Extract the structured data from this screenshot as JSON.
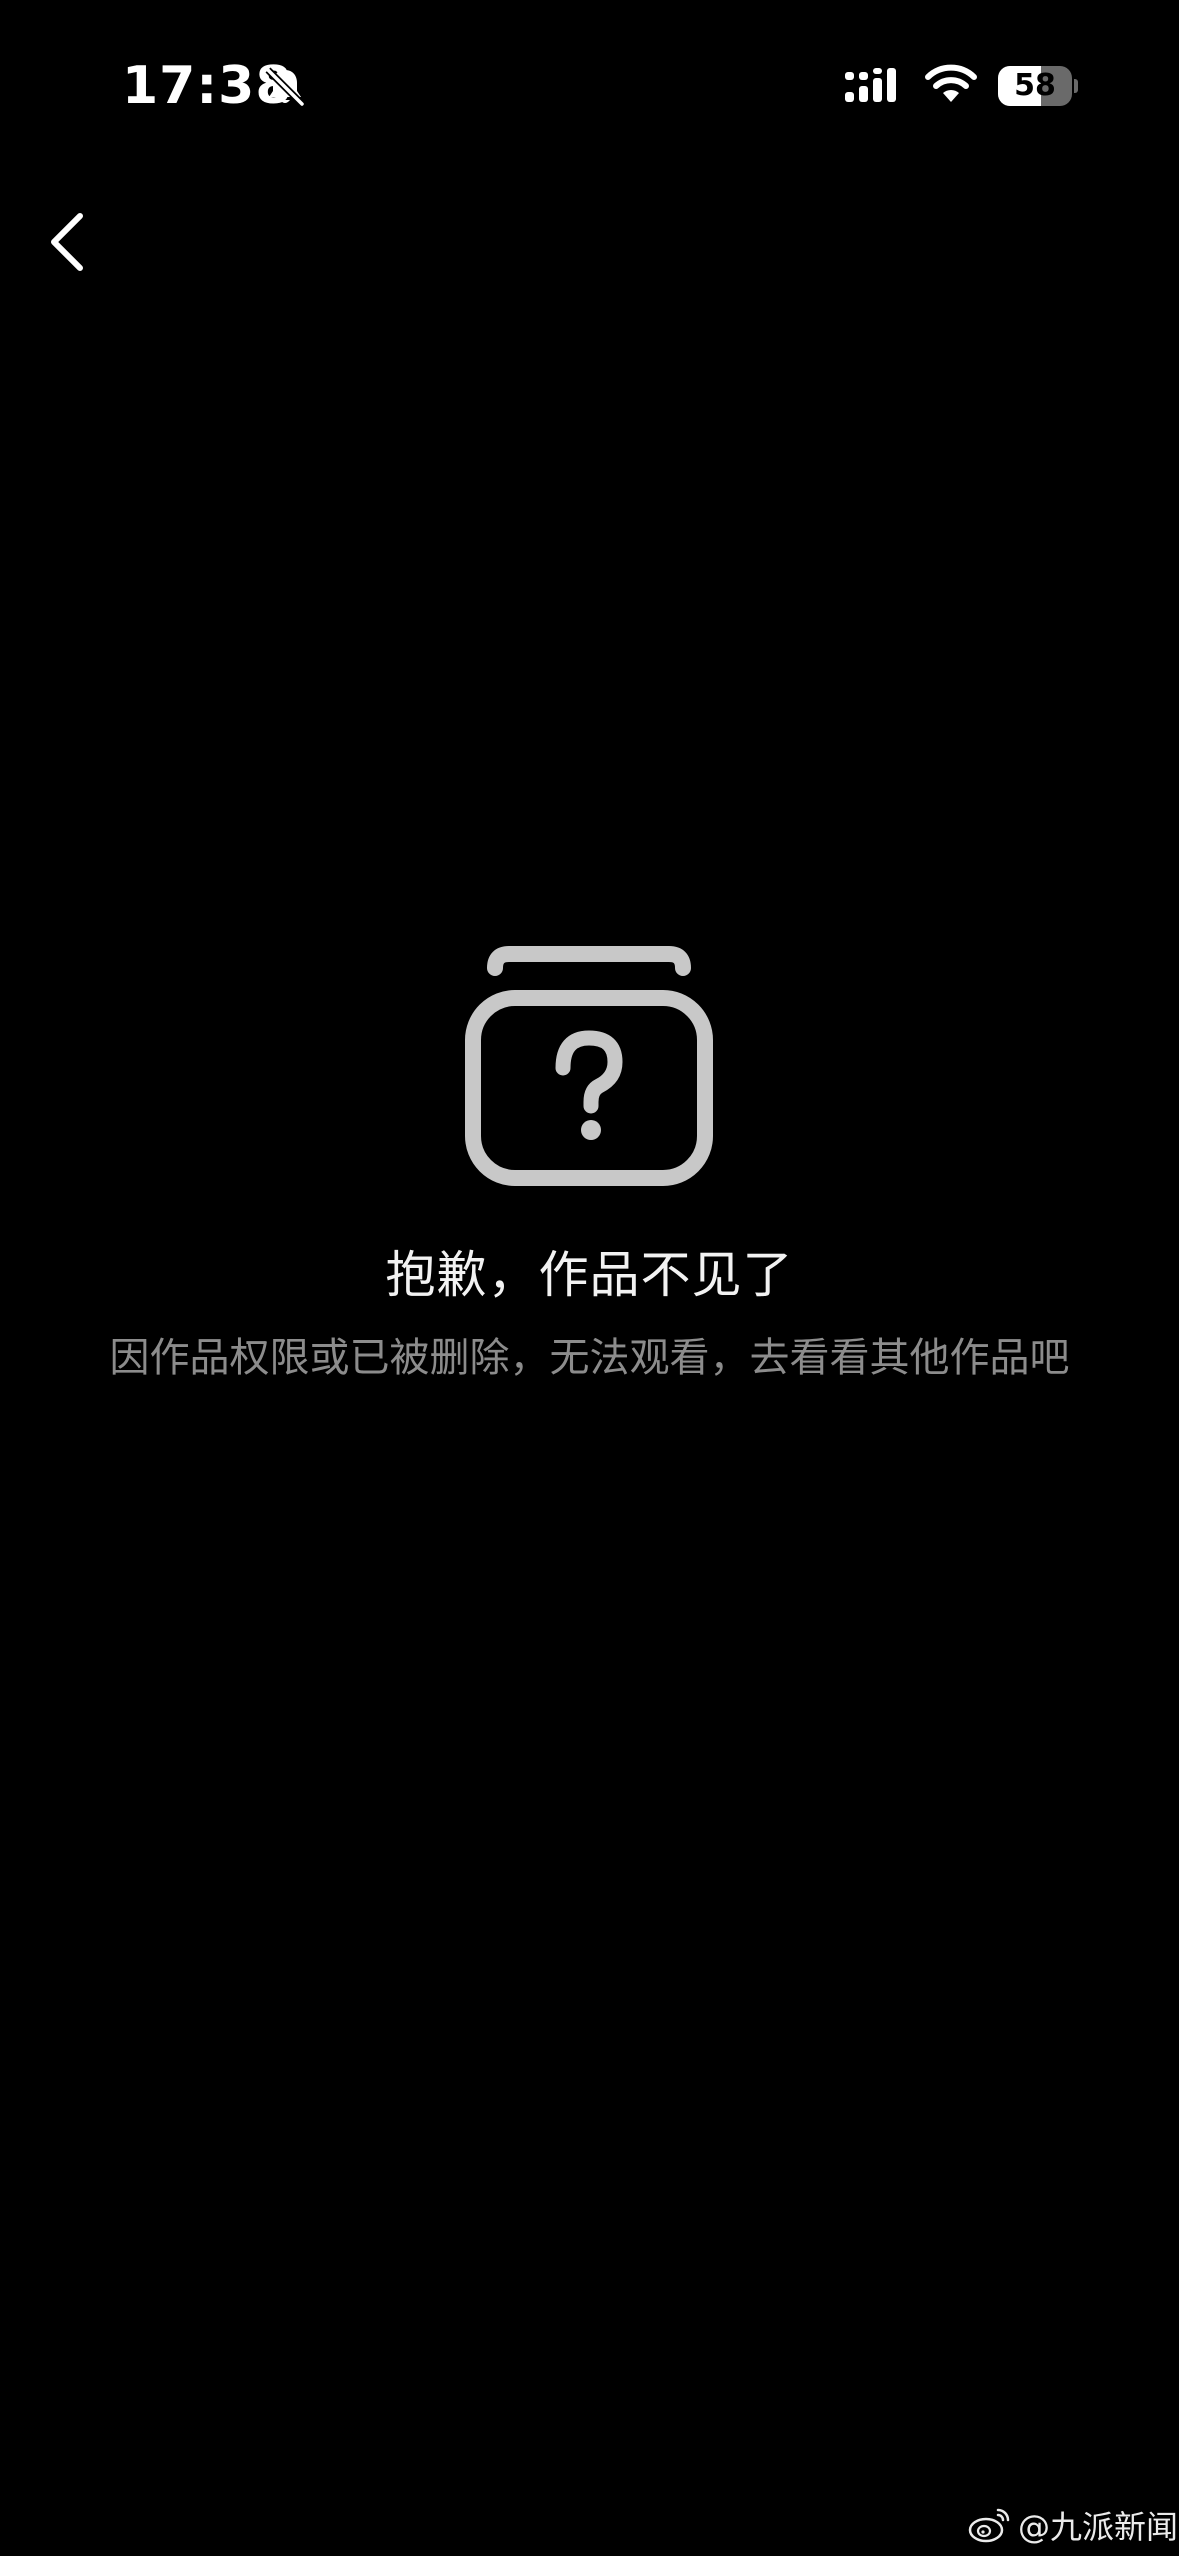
{
  "status_bar": {
    "time": "17:38",
    "battery_level": "58",
    "battery_fraction": 0.58,
    "icons": [
      "bell-muted-icon",
      "signal-icon",
      "wifi-icon",
      "battery-icon"
    ]
  },
  "nav": {
    "back_icon": "chevron-left-icon"
  },
  "empty_state": {
    "icon": "missing-content-icon",
    "title": "抱歉，作品不见了",
    "description": "因作品权限或已被删除，无法观看，去看看其他作品吧"
  },
  "watermark": {
    "text": "@九派新闻",
    "logo": "weibo-logo"
  },
  "colors": {
    "background": "#000000",
    "title": "#f2f2f2",
    "description": "#8c8c8c",
    "icon": "#c8c8c8"
  }
}
